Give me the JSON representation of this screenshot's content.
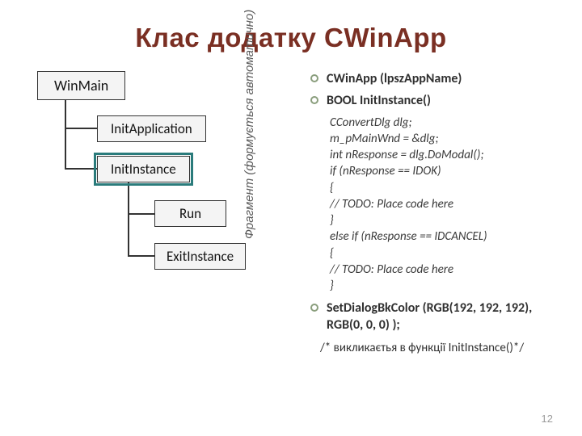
{
  "title": "Клас додатку CWinApp",
  "diagram": {
    "winmain": "WinMain",
    "initapp": "InitApplication",
    "initinst": "InitInstance",
    "run": "Run",
    "exit": "ExitInstance"
  },
  "vertical_label": "Фрагмент (формується автоматично)",
  "bullets": {
    "b1": "CWinApp (lpszAppName)",
    "b2": "BOOL InitInstance()",
    "code": "CConvertDlg dlg;\nm_pMainWnd = &dlg;\nint nResponse = dlg.DoModal();\nif (nResponse == IDOK)\n{\n// TODO: Place code here\n}\nelse if (nResponse == IDCANCEL)\n{\n// TODO: Place code here\n}",
    "b3": "SetDialogBkColor (RGB(192, 192, 192), RGB(0, 0, 0) );",
    "note": "/* викликаєтья в функції InitInstance()*/"
  },
  "page_number": "12"
}
